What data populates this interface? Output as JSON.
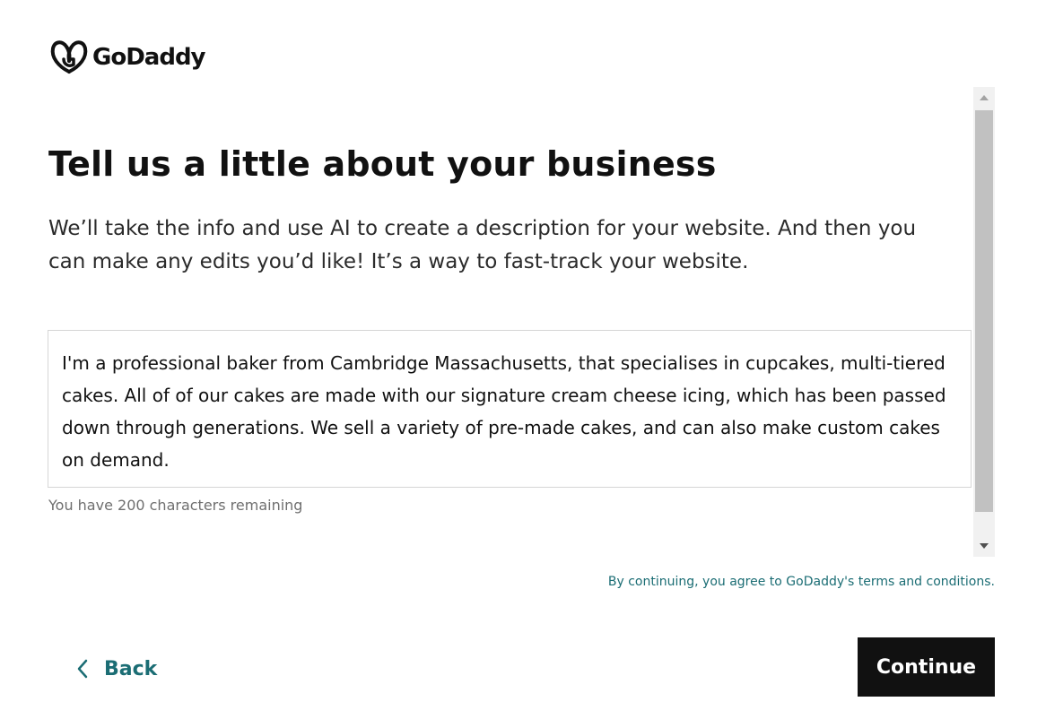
{
  "brand": {
    "name": "GoDaddy",
    "logo_icon": "godaddy-logo-icon"
  },
  "page": {
    "title": "Tell us a little about your business",
    "subtitle": "We’ll take the info and use AI to create a description for your website. And then you can make any edits you’d like! It’s a way to fast-track your website."
  },
  "description": {
    "value": "I'm a professional baker from Cambridge Massachusetts, that specialises in cupcakes, multi-tiered cakes. All of of our cakes are made with our signature cream cheese icing, which has been passed down through generations. We sell a variety of pre-made cakes, and can also make custom cakes on demand.",
    "char_count_text": "You have 200 characters remaining"
  },
  "terms": {
    "text": "By continuing, you agree to GoDaddy's terms and conditions."
  },
  "nav": {
    "back_label": "Back",
    "back_icon": "chevron-left-icon",
    "continue_label": "Continue"
  },
  "colors": {
    "accent": "#1b6d74",
    "primary_button_bg": "#111111",
    "text": "#111111",
    "muted": "#6f6f6f",
    "border": "#d6d6d6",
    "scrollbar_thumb": "#c1c1c1",
    "scrollbar_track": "#f1f1f1"
  }
}
